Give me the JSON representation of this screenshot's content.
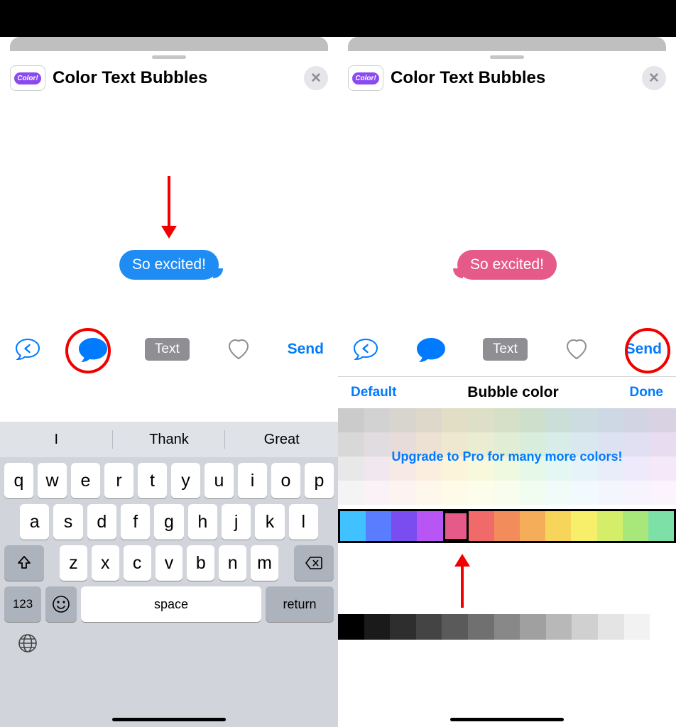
{
  "left": {
    "app_badge": "Color!",
    "title": "Color Text Bubbles",
    "bubble_text": "So excited!",
    "bubble_bg": "#1e8cf2",
    "toolbar": {
      "text_btn": "Text",
      "send": "Send"
    },
    "keyboard": {
      "predictions": [
        "I",
        "Thank",
        "Great"
      ],
      "row1": [
        "q",
        "w",
        "e",
        "r",
        "t",
        "y",
        "u",
        "i",
        "o",
        "p"
      ],
      "row2": [
        "a",
        "s",
        "d",
        "f",
        "g",
        "h",
        "j",
        "k",
        "l"
      ],
      "row3": [
        "z",
        "x",
        "c",
        "v",
        "b",
        "n",
        "m"
      ],
      "num": "123",
      "space": "space",
      "return": "return"
    }
  },
  "right": {
    "app_badge": "Color!",
    "title": "Color Text Bubbles",
    "bubble_text": "So excited!",
    "bubble_bg": "#e65a8a",
    "toolbar": {
      "text_btn": "Text",
      "send": "Send"
    },
    "picker": {
      "default": "Default",
      "title": "Bubble color",
      "done": "Done",
      "upgrade": "Upgrade to Pro for many more colors!",
      "locked_rows": [
        [
          "#777",
          "#888",
          "#9a8f7f",
          "#a89a74",
          "#b2a96a",
          "#a6ab6b",
          "#93ab6e",
          "#7eab7a",
          "#79a99a",
          "#7aa3b0",
          "#7e96b7",
          "#8a8eb8",
          "#9a8ab6"
        ],
        [
          "#9a9a9a",
          "#b0a2ae",
          "#c1a49e",
          "#cfb08e",
          "#d3c285",
          "#c9cf87",
          "#b2d090",
          "#9ccfa3",
          "#98ccc2",
          "#9bc3d5",
          "#a2b4da",
          "#b1aadc",
          "#c3a6d8"
        ],
        [
          "#c3c3c3",
          "#dac0d1",
          "#eac6bc",
          "#f3d3a9",
          "#f4e3a0",
          "#ecf0a3",
          "#d4efad",
          "#bdedc0",
          "#b9e9dc",
          "#bde0ef",
          "#c5cff2",
          "#d3c7f3",
          "#e2c3ef"
        ],
        [
          "#e2e2e2",
          "#f1dce9",
          "#fae2d9",
          "#fdebcc",
          "#fdf3c6",
          "#f8f9c8",
          "#ecf9d0",
          "#defadb",
          "#dbf7ee",
          "#ddf1fa",
          "#e2e8fb",
          "#ebe3fb",
          "#f3e1f9"
        ]
      ],
      "active_row": [
        "#3fc2ff",
        "#5a7dff",
        "#7a4df0",
        "#b755f5",
        "#e65a8a",
        "#f06a6a",
        "#f28c5a",
        "#f5ad5a",
        "#f7d45a",
        "#f7ef6a",
        "#d4ee6a",
        "#a8e87a",
        "#7de0a6"
      ],
      "selected_index": 4,
      "gray_row": [
        "#000000",
        "#1a1a1a",
        "#2e2e2e",
        "#444444",
        "#5a5a5a",
        "#707070",
        "#888888",
        "#a0a0a0",
        "#b8b8b8",
        "#d0d0d0",
        "#e4e4e4",
        "#f2f2f2",
        "#ffffff"
      ]
    }
  }
}
